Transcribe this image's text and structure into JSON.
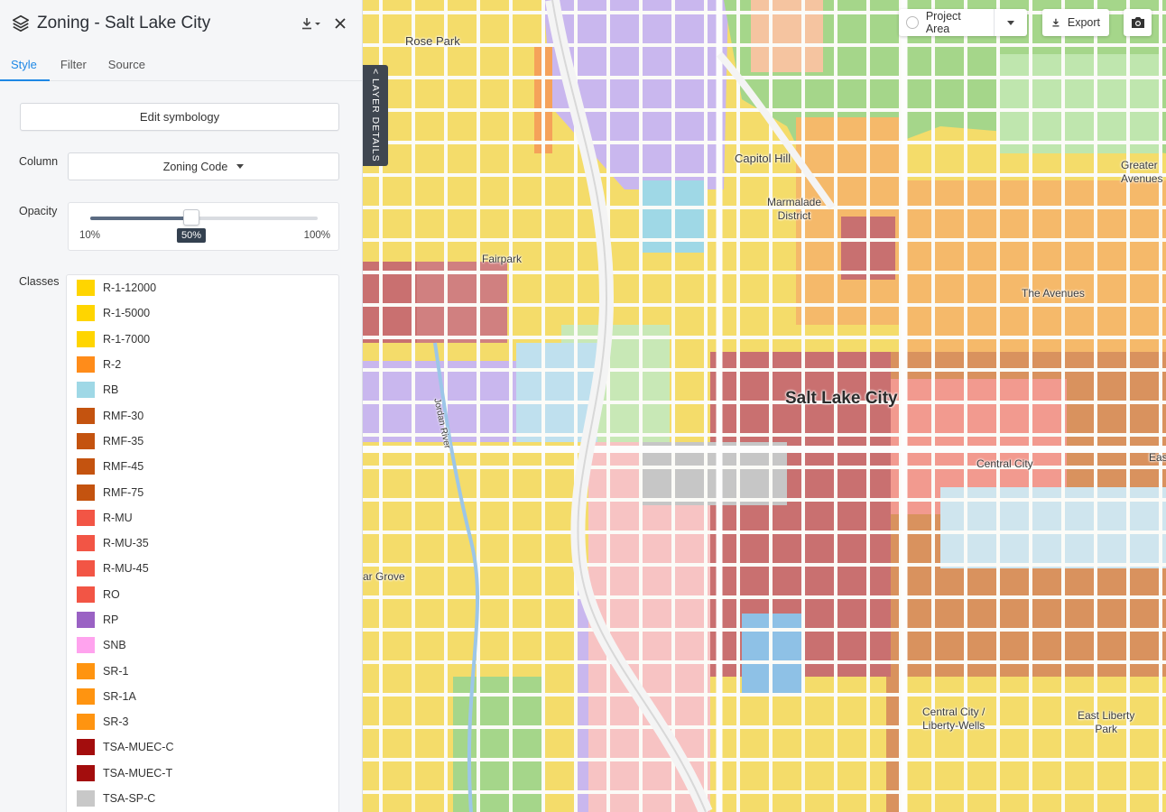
{
  "panel": {
    "title": "Zoning - Salt Lake City",
    "tabs": [
      {
        "label": "Style",
        "active": true
      },
      {
        "label": "Filter",
        "active": false
      },
      {
        "label": "Source",
        "active": false
      }
    ],
    "edit_symbology_label": "Edit symbology",
    "column": {
      "label": "Column",
      "value": "Zoning Code"
    },
    "opacity": {
      "label": "Opacity",
      "min_label": "10%",
      "max_label": "100%",
      "value_label": "50%",
      "min": 10,
      "max": 100,
      "value": 50
    },
    "classes_label": "Classes",
    "classes": [
      {
        "label": "R-1-12000",
        "color": "#ffd500"
      },
      {
        "label": "R-1-5000",
        "color": "#ffd500"
      },
      {
        "label": "R-1-7000",
        "color": "#ffd500"
      },
      {
        "label": "R-2",
        "color": "#ff8c1a"
      },
      {
        "label": "RB",
        "color": "#9fd8e6"
      },
      {
        "label": "RMF-30",
        "color": "#c4530f"
      },
      {
        "label": "RMF-35",
        "color": "#c4530f"
      },
      {
        "label": "RMF-45",
        "color": "#c4530f"
      },
      {
        "label": "RMF-75",
        "color": "#c4530f"
      },
      {
        "label": "R-MU",
        "color": "#f25545"
      },
      {
        "label": "R-MU-35",
        "color": "#f25545"
      },
      {
        "label": "R-MU-45",
        "color": "#f25545"
      },
      {
        "label": "RO",
        "color": "#f25545"
      },
      {
        "label": "RP",
        "color": "#9a62c4"
      },
      {
        "label": "SNB",
        "color": "#ffa3ee"
      },
      {
        "label": "SR-1",
        "color": "#ff9410"
      },
      {
        "label": "SR-1A",
        "color": "#ff9410"
      },
      {
        "label": "SR-3",
        "color": "#ff9410"
      },
      {
        "label": "TSA-MUEC-C",
        "color": "#a30d0d"
      },
      {
        "label": "TSA-MUEC-T",
        "color": "#a30d0d"
      },
      {
        "label": "TSA-SP-C",
        "color": "#c8c8c8"
      }
    ]
  },
  "map": {
    "layer_details_label": "< LAYER DETAILS",
    "project_area_label": "Project Area",
    "export_label": "Export",
    "places": {
      "rose_park": "Rose Park",
      "capitol_hill": "Capitol Hill",
      "marmalade": "Marmalade\nDistrict",
      "fairpark": "Fairpark",
      "greater_avenues": "Greater\nAvenues",
      "the_avenues": "The Avenues",
      "salt_lake_city": "Salt Lake City",
      "central_city": "Central City",
      "east": "Eas",
      "jordan_river": "Jordan River",
      "glendale": "ar Grove",
      "central_city_liberty": "Central City /\nLiberty-Wells",
      "east_liberty_park": "East Liberty\nPark"
    },
    "zone_colors": {
      "single_family": "#f4dc6a",
      "residential": "#f5b96a",
      "multifamily": "#d9925e",
      "mixed_use": "#f29a8f",
      "downtown": "#c97070",
      "business": "#9fd8e6",
      "light_industry": "#c9b7ee",
      "open_space": "#a5d68a",
      "gateway": "#f7c3c3",
      "institutional": "#c6c6c6"
    }
  }
}
